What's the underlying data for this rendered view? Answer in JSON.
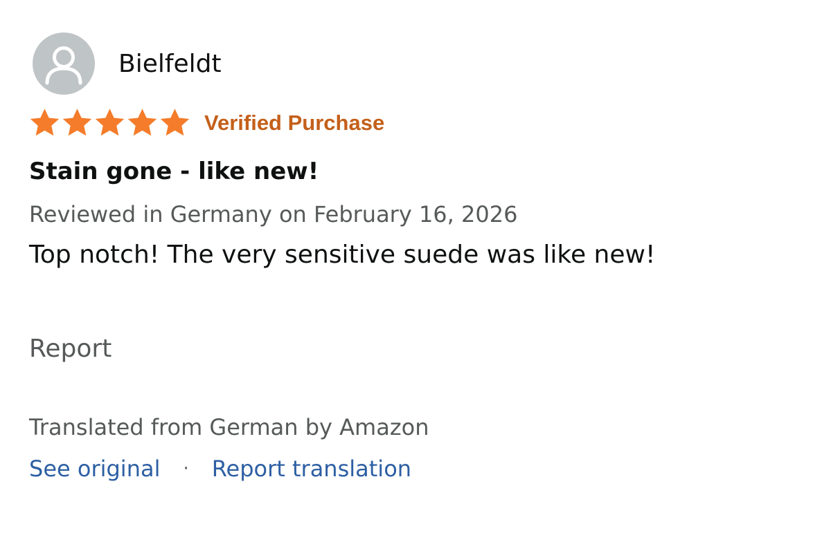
{
  "reviewer": {
    "name": "Bielfeldt",
    "avatar_icon": "default-user-avatar-icon",
    "avatar_bg": "#bfc4c6"
  },
  "rating": {
    "stars": 5,
    "max_stars": 5,
    "star_color": "#f47c2a",
    "badge": "Verified Purchase",
    "badge_color": "#c45f1a"
  },
  "review": {
    "title": "Stain gone - like new!",
    "meta": "Reviewed in Germany on February 16, 2026",
    "body": "Top notch! The very sensitive suede was like new!",
    "report_label": "Report"
  },
  "translation": {
    "note": "Translated from German by Amazon",
    "see_original_label": "See original",
    "separator": "·",
    "report_translation_label": "Report translation",
    "link_color": "#2d5fa3"
  }
}
